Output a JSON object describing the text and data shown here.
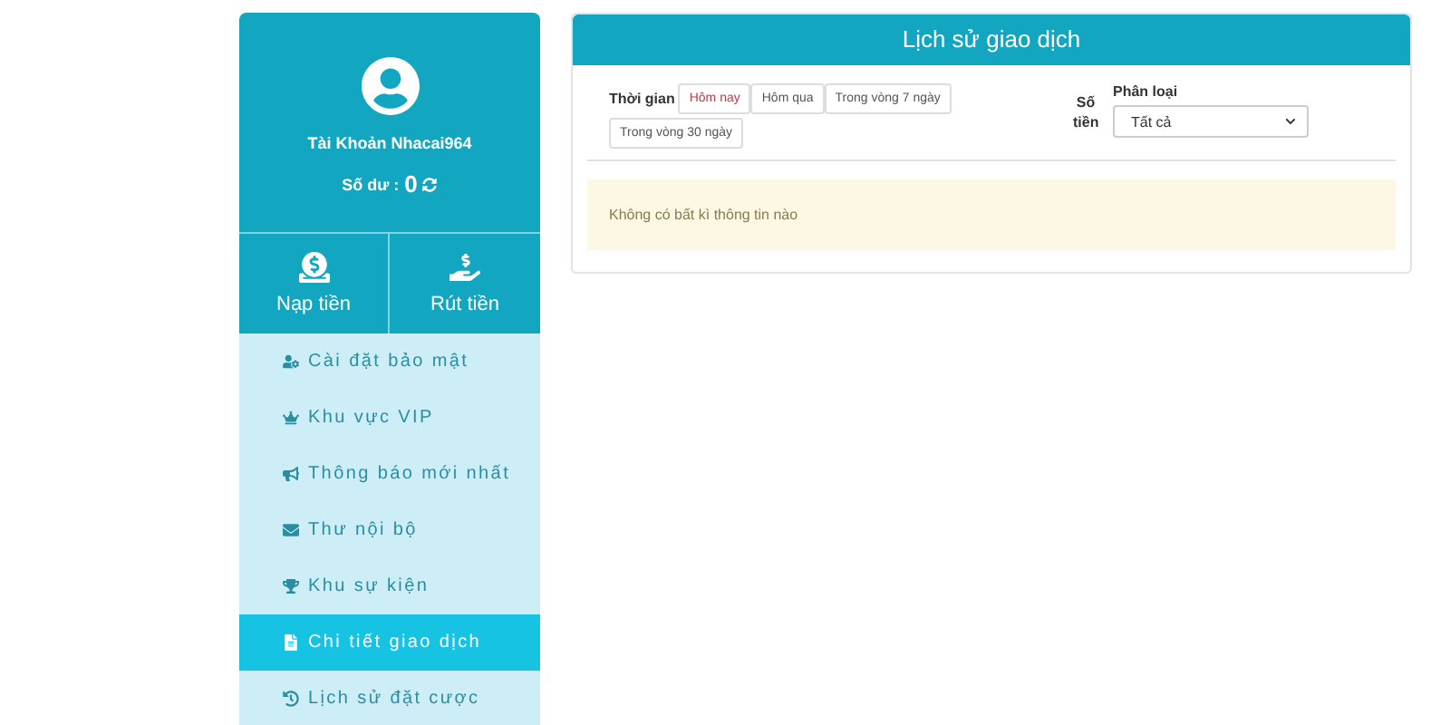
{
  "account": {
    "username": "Tài Khoản Nhacai964",
    "balance_label": "Số dư :",
    "balance": "0"
  },
  "actions": [
    {
      "label": "Nạp tiền"
    },
    {
      "label": "Rút tiền"
    }
  ],
  "menu": [
    {
      "label": "Cài đặt bảo mật",
      "selected": false
    },
    {
      "label": "Khu vực VIP",
      "selected": false
    },
    {
      "label": "Thông báo mới nhất",
      "selected": false
    },
    {
      "label": "Thư nội bộ",
      "selected": false
    },
    {
      "label": "Khu sự kiện",
      "selected": false
    },
    {
      "label": "Chi tiết giao dịch",
      "selected": true
    },
    {
      "label": "Lịch sử đặt cược",
      "selected": false
    }
  ],
  "panel": {
    "title": "Lịch sử giao dịch",
    "time_label": "Thời gian",
    "time_filters": [
      {
        "label": "Hôm nay",
        "selected": true
      },
      {
        "label": "Hôm qua",
        "selected": false
      },
      {
        "label": "Trong vòng 7 ngày",
        "selected": false
      },
      {
        "label": "Trong vòng 30 ngày",
        "selected": false
      }
    ],
    "amount_label": "Số tiền",
    "type_label": "Phân loại",
    "type_value": "Tất cả",
    "empty_message": "Không có bất kì thông tin nào"
  }
}
